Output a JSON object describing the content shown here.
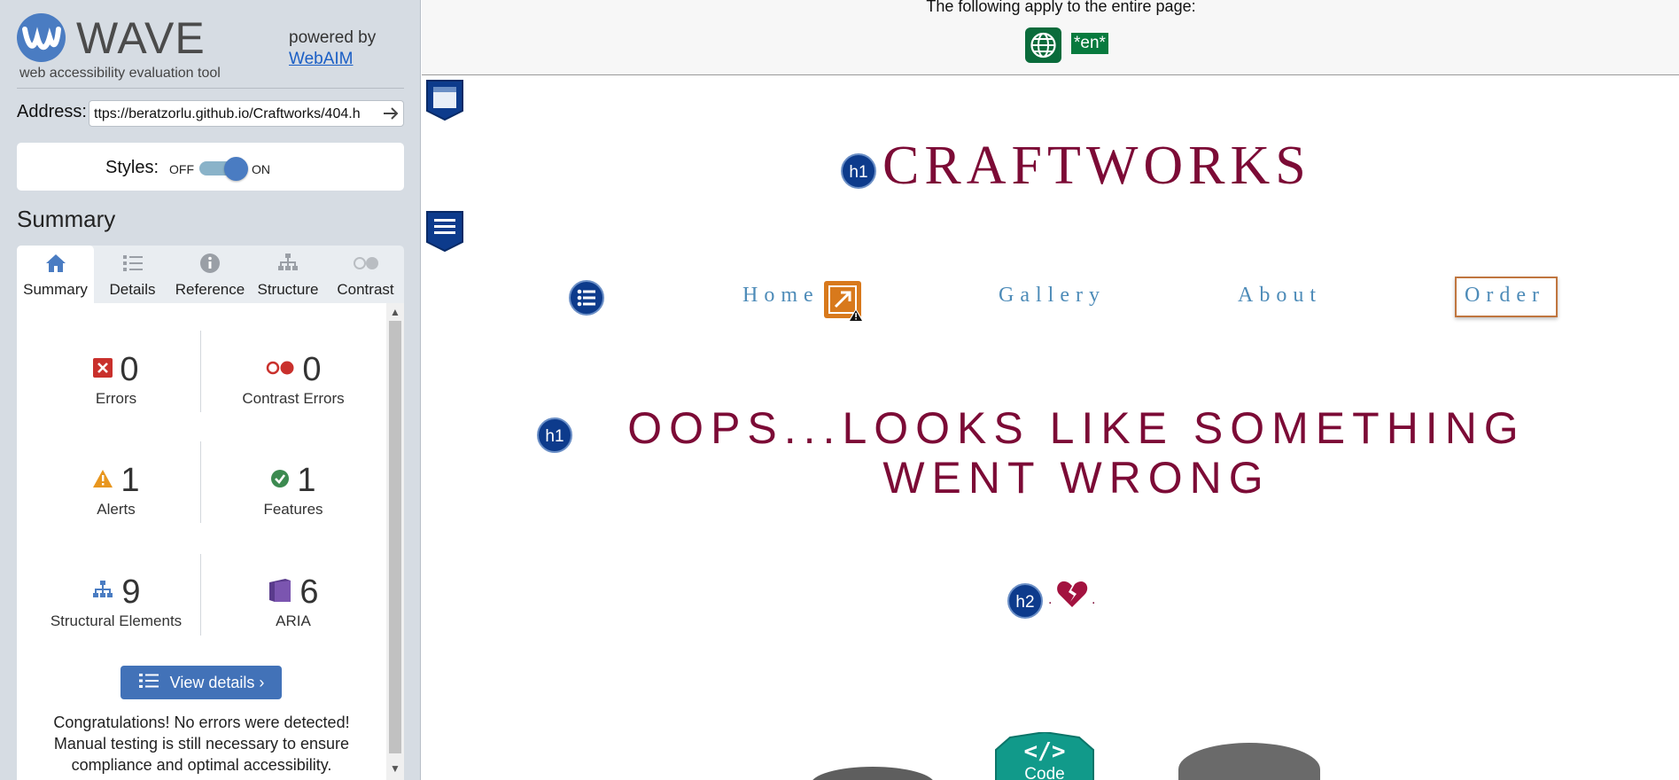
{
  "wave": {
    "logo_text": "WAVE",
    "logo_subtitle": "web accessibility evaluation tool",
    "powered_by": "powered by",
    "webaim_link": "WebAIM",
    "address_label": "Address:",
    "address_value": "ttps://beratzorlu.github.io/Craftworks/404.h",
    "styles_label": "Styles:",
    "styles_off": "OFF",
    "styles_on": "ON",
    "styles_toggle_state": "on",
    "summary_title": "Summary",
    "tabs": [
      {
        "label": "Summary",
        "icon": "home-icon",
        "active": true
      },
      {
        "label": "Details",
        "icon": "list-icon",
        "active": false
      },
      {
        "label": "Reference",
        "icon": "info-icon",
        "active": false
      },
      {
        "label": "Structure",
        "icon": "sitemap-icon",
        "active": false
      },
      {
        "label": "Contrast",
        "icon": "contrast-toggle-icon",
        "active": false
      }
    ],
    "stats": {
      "errors": {
        "value": "0",
        "label": "Errors",
        "color": "#c9302c"
      },
      "contrast_errors": {
        "value": "0",
        "label": "Contrast Errors",
        "color": "#c9302c"
      },
      "alerts": {
        "value": "1",
        "label": "Alerts",
        "color": "#e8961e"
      },
      "features": {
        "value": "1",
        "label": "Features",
        "color": "#3c8a50"
      },
      "structural": {
        "value": "9",
        "label": "Structural Elements",
        "color": "#4a7cc2"
      },
      "aria": {
        "value": "6",
        "label": "ARIA",
        "color": "#5a3b8c"
      }
    },
    "view_details": "View details ›",
    "congrats": "Congratulations! No errors were detected! Manual testing is still necessary to ensure compliance and optimal accessibility."
  },
  "page": {
    "topbar_text": "The following apply to the entire page:",
    "lang_badge": "*en*",
    "brand": "CRAFTWORKS",
    "h1_badge": "h1",
    "h2_badge": "h2",
    "nav": [
      "Home",
      "Gallery",
      "About",
      "Order"
    ],
    "oops_heading": "OOPS...LOOKS LIKE SOMETHING WENT WRONG",
    "code_badge": "Code",
    "code_glyph": "</>",
    "brand_color": "#7c0b36",
    "nav_color": "#4d8bb8"
  }
}
